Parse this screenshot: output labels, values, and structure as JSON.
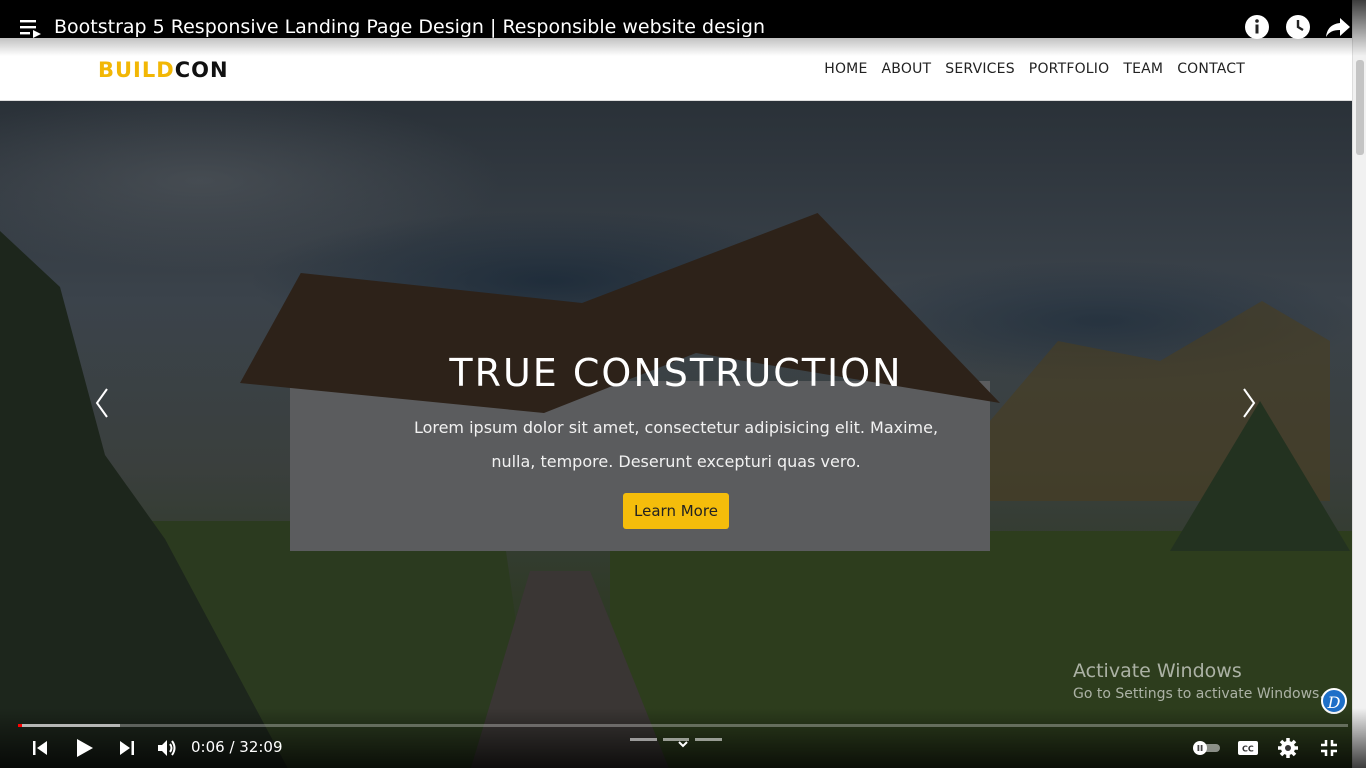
{
  "video": {
    "title": "Bootstrap 5 Responsive Landing Page Design | Responsible website design",
    "current_time": "0:06",
    "duration": "32:09",
    "time_display": "0:06 / 32:09",
    "progress_fraction": 0.0031,
    "buffered_fraction": 0.077
  },
  "site": {
    "brand_part1": "BUILD",
    "brand_part2": "CON",
    "nav": [
      "HOME",
      "ABOUT",
      "SERVICES",
      "PORTFOLIO",
      "TEAM",
      "CONTACT"
    ],
    "hero_title": "TRUE CONSTRUCTION",
    "hero_text": "Lorem ipsum dolor sit amet, consectetur adipisicing elit. Maxime, nulla, tempore. Deserunt excepturi quas vero.",
    "hero_button": "Learn More"
  },
  "watermark": {
    "line1": "Activate Windows",
    "line2": "Go to Settings to activate Windows."
  },
  "extension_badge": "D",
  "colors": {
    "brand_accent": "#f2b705",
    "button": "#f5bd0b",
    "progress": "#ff0000"
  },
  "icons": {
    "top": [
      "playlist-icon",
      "info-icon",
      "watch-later-icon",
      "share-icon"
    ],
    "bottom": [
      "previous-icon",
      "play-icon",
      "next-icon",
      "volume-icon",
      "autoplay-toggle-icon",
      "captions-icon",
      "settings-icon",
      "exit-fullscreen-icon"
    ]
  }
}
